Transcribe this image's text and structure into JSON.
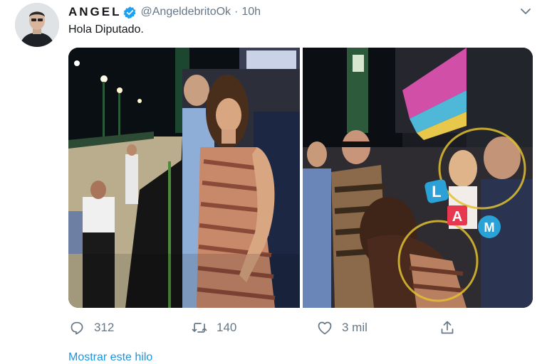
{
  "tweet": {
    "author_name": "ANGEL",
    "handle": "@AngeldebritoOk",
    "separator": "·",
    "time": "10h",
    "text": "Hola Diputado.",
    "verified_color": "#1da1f2"
  },
  "media": {
    "photos": [
      {
        "description": "stadium"
      },
      {
        "description": "crowd"
      }
    ],
    "stickers": [
      "L",
      "A",
      "M"
    ],
    "sticker_colors": {
      "L": "#2aa2d8",
      "A": "#e8384f",
      "M": "#2aa2d8"
    }
  },
  "actions": {
    "reply_count": "312",
    "retweet_count": "140",
    "like_count": "3 mil"
  },
  "show_thread": "Mostrar este hilo",
  "colors": {
    "secondary_text": "#657786",
    "link": "#1b95e0"
  }
}
